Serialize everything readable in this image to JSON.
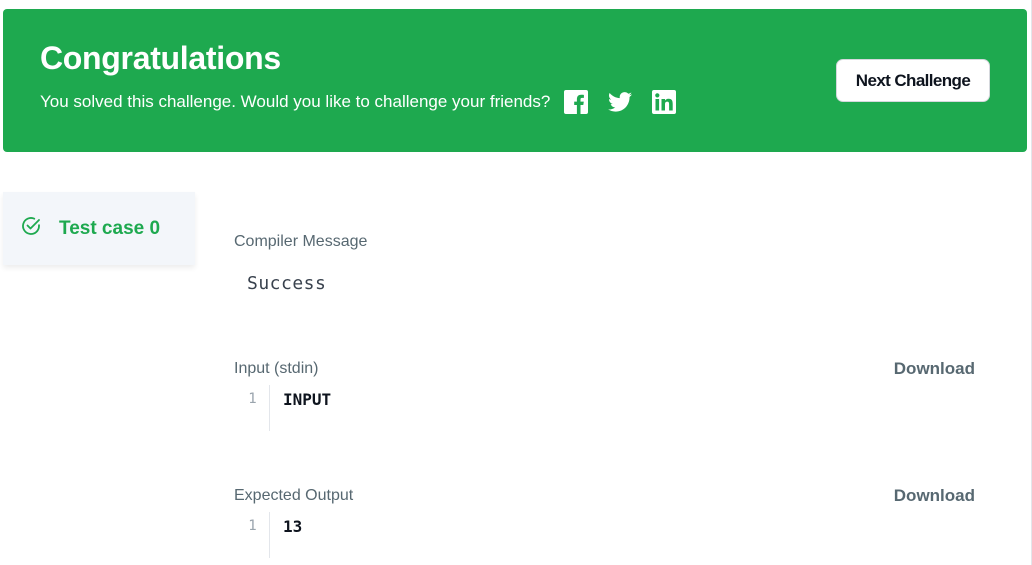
{
  "banner": {
    "title": "Congratulations",
    "subtitle": "You solved this challenge. Would you like to challenge your friends?",
    "social": [
      "facebook-icon",
      "twitter-icon",
      "linkedin-icon"
    ],
    "next_button_label": "Next Challenge",
    "color": "#1ea94f"
  },
  "sidebar": {
    "testcase_label": "Test case 0",
    "status_icon": "check-circle-icon",
    "accent": "#1ea94f"
  },
  "main": {
    "compiler": {
      "label": "Compiler Message",
      "message": "Success"
    },
    "input": {
      "label": "Input (stdin)",
      "download_label": "Download",
      "lines": [
        {
          "number": "1",
          "text": "INPUT"
        }
      ]
    },
    "expected": {
      "label": "Expected Output",
      "download_label": "Download",
      "lines": [
        {
          "number": "1",
          "text": "13"
        }
      ]
    }
  }
}
